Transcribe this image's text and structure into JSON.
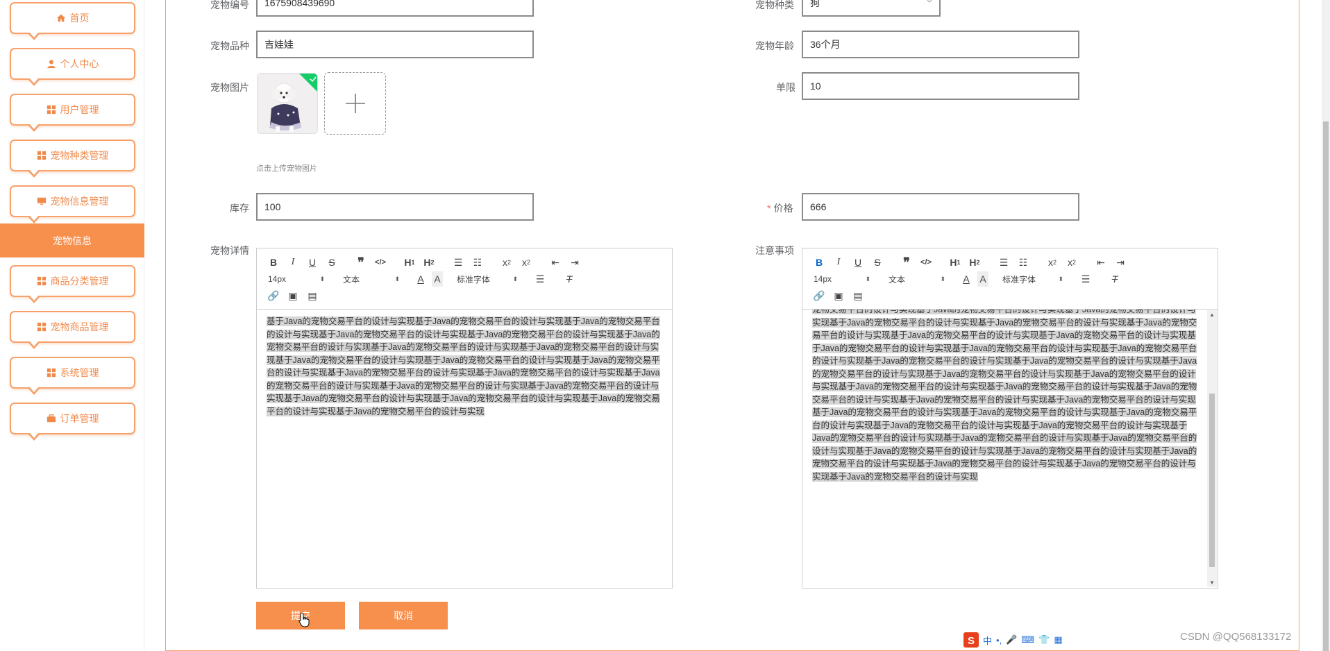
{
  "sidebar": {
    "items": [
      {
        "label": "首页",
        "icon": "home-icon"
      },
      {
        "label": "个人中心",
        "icon": "user-icon"
      },
      {
        "label": "用户管理",
        "icon": "grid-icon"
      },
      {
        "label": "宠物种类管理",
        "icon": "grid-icon"
      },
      {
        "label": "宠物信息管理",
        "icon": "monitor-icon"
      },
      {
        "label": "商品分类管理",
        "icon": "grid-icon"
      },
      {
        "label": "宠物商品管理",
        "icon": "grid-icon"
      },
      {
        "label": "系统管理",
        "icon": "grid-icon"
      },
      {
        "label": "订单管理",
        "icon": "briefcase-icon"
      }
    ],
    "active_sub": "宠物信息"
  },
  "form": {
    "pet_no": {
      "label": "宠物编号",
      "value": "1675908439690"
    },
    "pet_type": {
      "label": "宠物种类",
      "value": "狗"
    },
    "breed": {
      "label": "宠物品种",
      "value": "吉娃娃"
    },
    "age": {
      "label": "宠物年龄",
      "value": "36个月"
    },
    "image": {
      "label": "宠物图片",
      "hint": "点击上传宠物图片"
    },
    "limit": {
      "label": "单限",
      "value": "10"
    },
    "stock": {
      "label": "库存",
      "value": "100"
    },
    "price": {
      "label": "价格",
      "required_mark": "*",
      "value": "666"
    },
    "detail": {
      "label": "宠物详情"
    },
    "notes": {
      "label": "注意事项"
    }
  },
  "editor": {
    "font_size": "14px",
    "text_type": "文本",
    "font_family": "标准字体"
  },
  "detail_content": "基于Java的宠物交易平台的设计与实现基于Java的宠物交易平台的设计与实现基于Java的宠物交易平台的设计与实现基于Java的宠物交易平台的设计与实现基于Java的宠物交易平台的设计与实现基于Java的宠物交易平台的设计与实现基于Java的宠物交易平台的设计与实现基于Java的宠物交易平台的设计与实现基于Java的宠物交易平台的设计与实现基于Java的宠物交易平台的设计与实现基于Java的宠物交易平台的设计与实现基于Java的宠物交易平台的设计与实现基于Java的宠物交易平台的设计与实现基于Java的宠物交易平台的设计与实现基于Java的宠物交易平台的设计与实现基于Java的宠物交易平台的设计与实现基于Java的宠物交易平台的设计与实现基于Java的宠物交易平台的设计与实现基于Java的宠物交易平台的设计与实现基于Java的宠物交易平台的设计与实现",
  "notes_content": "宠物交易平台的设计与实现基于Java的宠物交易平台的设计与实现基于Java的宠物交易平台的设计与实现基于Java的宠物交易平台的设计与实现基于Java的宠物交易平台的设计与实现基于Java的宠物交易平台的设计与实现基于Java的宠物交易平台的设计与实现基于Java的宠物交易平台的设计与实现基于Java的宠物交易平台的设计与实现基于Java的宠物交易平台的设计与实现基于Java的宠物交易平台的设计与实现基于Java的宠物交易平台的设计与实现基于Java的宠物交易平台的设计与实现基于Java的宠物交易平台的设计与实现基于Java的宠物交易平台的设计与实现基于Java的宠物交易平台的设计与实现基于Java的宠物交易平台的设计与实现基于Java的宠物交易平台的设计与实现基于Java的宠物交易平台的设计与实现基于Java的宠物交易平台的设计与实现基于Java的宠物交易平台的设计与实现基于Java的宠物交易平台的设计与实现基于Java的宠物交易平台的设计与实现基于Java的宠物交易平台的设计与实现基于Java的宠物交易平台的设计与实现基于Java的宠物交易平台的设计与实现基于Java的宠物交易平台的设计与实现基于Java的宠物交易平台的设计与实现基于Java的宠物交易平台的设计与实现基于Java的宠物交易平台的设计与实现基于Java的宠物交易平台的设计与实现基于Java的宠物交易平台的设计与实现基于Java的宠物交易平台的设计与实现基于Java的宠物交易平台的设计与实现基于Java的宠物交易平台的设计与实现",
  "buttons": {
    "submit": "提交",
    "cancel": "取消"
  },
  "ime": {
    "lang": "中"
  },
  "watermark": "CSDN @QQ568133172",
  "colors": {
    "accent": "#f78f4d",
    "accent_border": "#f7a06a",
    "link_active": "#0066cc"
  }
}
